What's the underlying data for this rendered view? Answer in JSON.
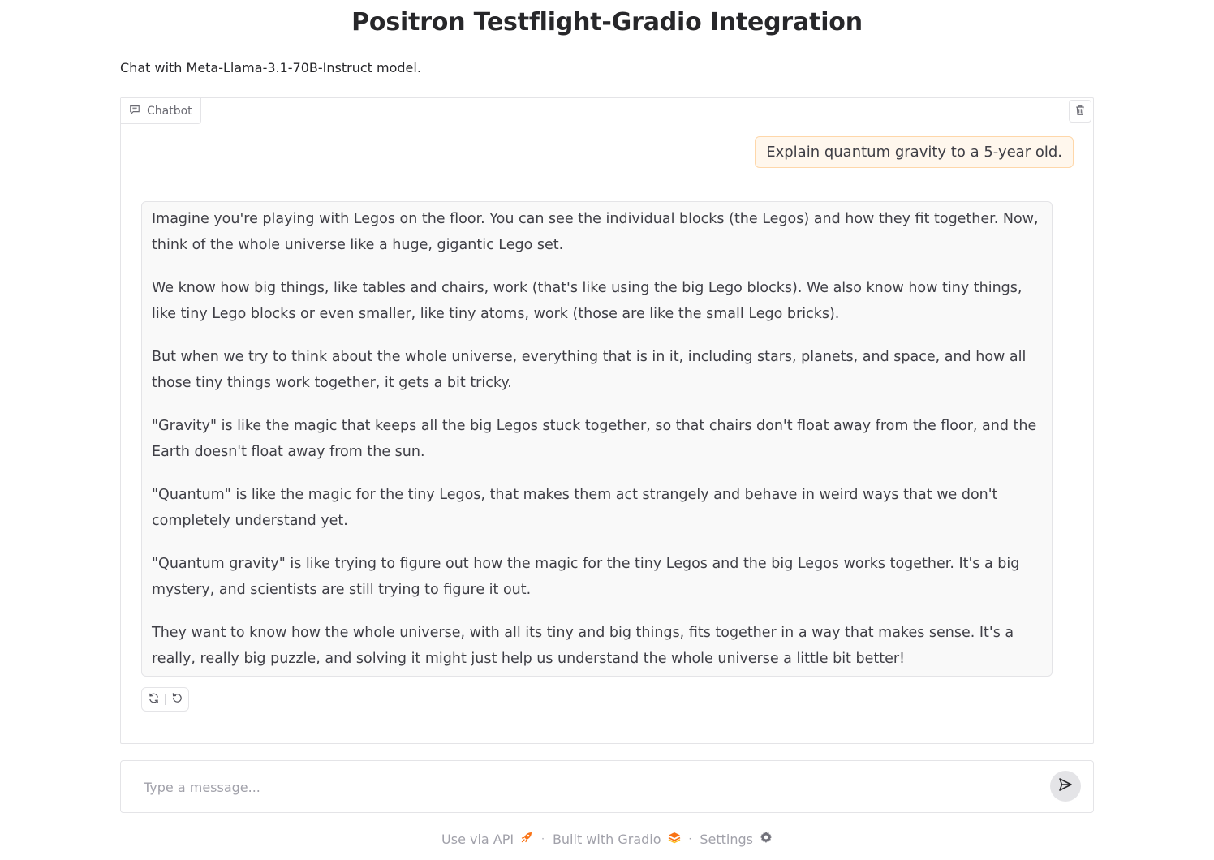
{
  "header": {
    "title": "Positron Testflight-Gradio Integration",
    "description": "Chat with Meta-Llama-3.1-70B-Instruct model."
  },
  "chatbot": {
    "label": "Chatbot",
    "label_icon": "chat-bubble-icon",
    "clear_icon": "trash-icon",
    "messages": [
      {
        "role": "user",
        "text": "Explain quantum gravity to a 5-year old."
      },
      {
        "role": "assistant",
        "paragraphs": [
          "Imagine you're playing with Legos on the floor. You can see the individual blocks (the Legos) and how they fit together. Now, think of the whole universe like a huge, gigantic Lego set.",
          "We know how big things, like tables and chairs, work (that's like using the big Lego blocks). We also know how tiny things, like tiny Lego blocks or even smaller, like tiny atoms, work (those are like the small Lego bricks).",
          "But when we try to think about the whole universe, everything that is in it, including stars, planets, and space, and how all those tiny things work together, it gets a bit tricky.",
          "\"Gravity\" is like the magic that keeps all the big Legos stuck together, so that chairs don't float away from the floor, and the Earth doesn't float away from the sun.",
          "\"Quantum\" is like the magic for the tiny Legos, that makes them act strangely and behave in weird ways that we don't completely understand yet.",
          "\"Quantum gravity\" is like trying to figure out how the magic for the tiny Legos and the big Legos works together. It's a big mystery, and scientists are still trying to figure it out.",
          "They want to know how the whole universe, with all its tiny and big things, fits together in a way that makes sense. It's a really, really big puzzle, and solving it might just help us understand the whole universe a little bit better!"
        ]
      }
    ],
    "actions": [
      "retry-icon",
      "undo-icon"
    ]
  },
  "input": {
    "placeholder": "Type a message...",
    "value": "",
    "send_icon": "send-icon"
  },
  "footer": {
    "api_label": "Use via API",
    "built_label": "Built with Gradio",
    "settings_label": "Settings",
    "separator": "·"
  },
  "colors": {
    "user_bubble_bg": "#fff7ed",
    "user_bubble_border": "#fed7aa",
    "bot_bubble_bg": "#f9f9f9",
    "accent": "#f97316"
  }
}
